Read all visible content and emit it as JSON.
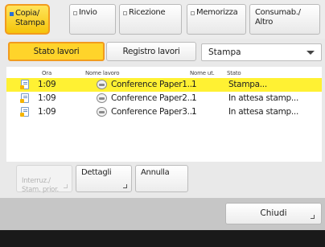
{
  "tabs": [
    {
      "label": "Copia/\nStampa",
      "active": true
    },
    {
      "label": "Invio",
      "active": false
    },
    {
      "label": "Ricezione",
      "active": false
    },
    {
      "label": "Memorizza",
      "active": false
    },
    {
      "label": "Consumab./\nAltro",
      "active": false
    }
  ],
  "filters": {
    "job_status": "Stato lavori",
    "job_log": "Registro lavori",
    "type_select": "Stampa"
  },
  "table": {
    "headers": {
      "time": "Ora",
      "name": "Nome lavoro",
      "count": "Nome ut.",
      "status": "Stato"
    },
    "rows": [
      {
        "time": "1:09",
        "name": "Conference Paper1...",
        "count": "1",
        "status": "Stampa...",
        "selected": true
      },
      {
        "time": "1:09",
        "name": "Conference Paper2...",
        "count": "1",
        "status": "In attesa stamp...",
        "selected": false
      },
      {
        "time": "1:09",
        "name": "Conference Paper3...",
        "count": "1",
        "status": "In attesa stamp...",
        "selected": false
      }
    ]
  },
  "actions": {
    "interrupt": "Interruz./\nStam. prior.",
    "details": "Dettagli",
    "cancel": "Annulla"
  },
  "close_label": "Chiudi",
  "colors": {
    "accent": "#ffd42a",
    "accent_border": "#f29b1e",
    "selected_row": "#fff133"
  }
}
